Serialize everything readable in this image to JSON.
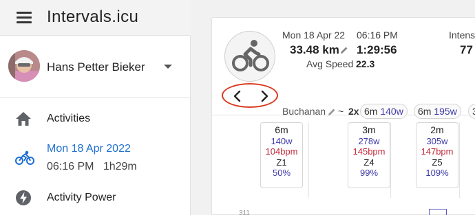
{
  "app": {
    "title": "Intervals.icu"
  },
  "user": {
    "name": "Hans Petter Bieker"
  },
  "nav": {
    "activities_label": "Activities",
    "activity_date": "Mon 18 Apr 2022",
    "activity_time": "06:16 PM   1h29m",
    "power_label": "Activity Power"
  },
  "activity": {
    "date": "Mon 18 Apr 22",
    "time": "06:16 PM",
    "distance": "33.48 km",
    "duration": "1:29:56",
    "avg_speed_label": "Avg Speed",
    "avg_speed": "22.3",
    "intensity_label": "Intens",
    "intensity": "77",
    "name": "Buchanan",
    "tilde": "~",
    "reps": "2x",
    "chips": [
      {
        "dur": "6m",
        "watts": "140w"
      },
      {
        "dur": "6m",
        "watts": "195w"
      },
      {
        "dur": "3",
        "watts": ""
      }
    ]
  },
  "intervals": [
    {
      "dur": "6m",
      "watts": "140w",
      "bpm": "104bpm",
      "zone": "Z1",
      "pct": "50%"
    },
    {
      "dur": "3m",
      "watts": "278w",
      "bpm": "145bpm",
      "zone": "Z4",
      "pct": "99%"
    },
    {
      "dur": "2m",
      "watts": "305w",
      "bpm": "147bpm",
      "zone": "Z5",
      "pct": "109%"
    }
  ],
  "chart_axis_label": "311",
  "colors": {
    "accent_blue": "#1e6fd1",
    "watts_purple": "#3d3aa8",
    "bpm_red": "#c0283a",
    "annotation_red": "#d9391e"
  },
  "icons": {
    "menu": "hamburger-menu-icon",
    "home": "home-icon",
    "bike": "bicycle-icon",
    "power": "lightning-bolt-icon",
    "edit": "pencil-icon",
    "prev": "chevron-left-icon",
    "next": "chevron-right-icon",
    "caret": "caret-down-icon"
  }
}
